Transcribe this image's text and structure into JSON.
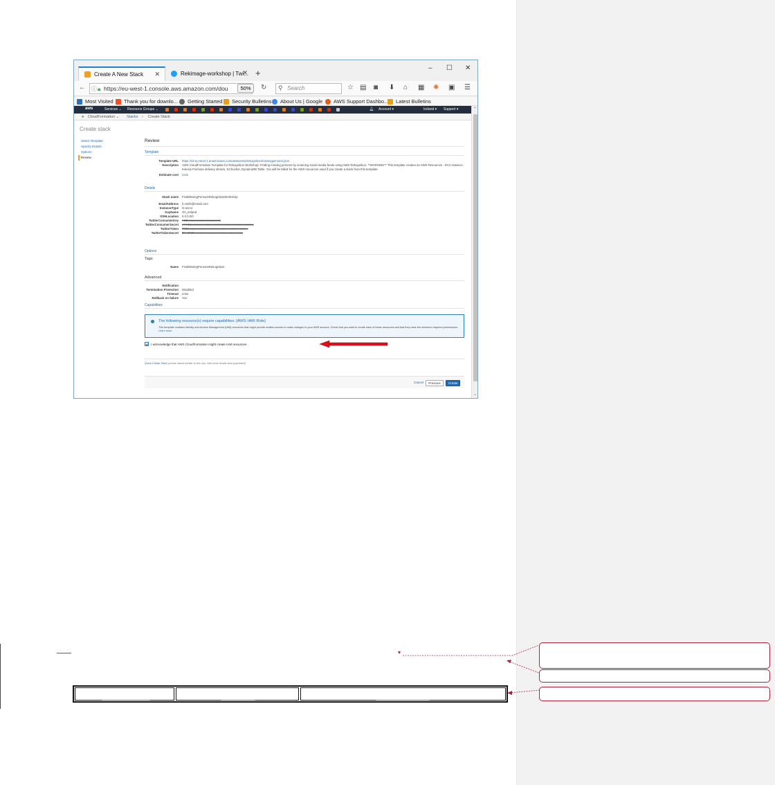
{
  "browser": {
    "tabs": [
      {
        "label": "Create A New Stack",
        "close": "✕"
      },
      {
        "label": "Rekimage-workshop | Twi...",
        "close": "✕"
      }
    ],
    "new_tab": "+",
    "window_controls": {
      "minimize": "–",
      "maximize": "☐",
      "close": "✕"
    },
    "url": "https://eu-west-1.console.aws.amazon.com/dou",
    "zoom": "50%",
    "search_placeholder": "Search",
    "bookmarks": [
      {
        "label": "Most Visited",
        "color": "#2f6fb8"
      },
      {
        "label": "Thank you for downlo...",
        "color": "#f25022"
      },
      {
        "label": "Getting Started",
        "color": "#666666"
      },
      {
        "label": "Security Bulletins",
        "color": "#e3a21a"
      },
      {
        "label": "About Us | Google",
        "color": "#4285f4"
      },
      {
        "label": "AWS Support Dashbo...",
        "color": "#e45b1b"
      },
      {
        "label": "Latest Bulletins",
        "color": "#e3a21a"
      }
    ]
  },
  "aws": {
    "logo": "aws",
    "services": "Services ⌄",
    "resource_groups": "Resource Groups ⌄",
    "account_menu": "Account ▾",
    "region": "Ireland ▾",
    "support": "Support ▾",
    "service_name": "CloudFormation ⌄",
    "breadcrumb": [
      "Stacks",
      "Create Stack"
    ],
    "page_title": "Create stack",
    "steps": [
      "Select Template",
      "Specify Details",
      "Options",
      "Review"
    ],
    "review": {
      "heading": "Review",
      "template_section": "Template",
      "template_rows": [
        {
          "k": "Template URL",
          "v": "https://s3-eu-west-1.amazonaws.com/awsevents/rekognition/missingpersons.json",
          "link": true
        },
        {
          "k": "Description",
          "v": "AWS CloudFormation Template for Rekognition Workshop: Finding missing persons by scanning social media feeds using AWS Rekognition. **WARNING** This template creates an AWS Resources - EC2 instance, Kinesis Firehose delivery stream, S3 bucket, DynamoDB Table. You will be billed for the AWS resources used if you create a stack from this template.",
          "link": false
        },
        {
          "k": "Estimate cost",
          "v": "Cost",
          "link": true
        }
      ],
      "details_section": "Details",
      "stack_name": {
        "k": "Stack name",
        "v": "FindMissingPersonsRekognitionWorkshop"
      },
      "param_rows": [
        {
          "k": "EmailAddress",
          "v": "b.smith@email.com",
          "strike": false
        },
        {
          "k": "InstanceType",
          "v": "t2.micro",
          "strike": false
        },
        {
          "k": "KeyName",
          "v": "cfn_ireland",
          "strike": false
        },
        {
          "k": "SSHLocation",
          "v": "0.0.0.0/0",
          "strike": false
        },
        {
          "k": "TwitterConsumerKey",
          "v": "H5Dxxxxxxxxxxxxxxxxxxxxxx",
          "strike": true
        },
        {
          "k": "TwitterConsumerSecret",
          "v": "xYmbaxxxxxxxxxxxxxxxxxxxxxxxxxxxxxxxxxxxxxxxxxx",
          "strike": true
        },
        {
          "k": "TwitterToken",
          "v": "7003xxxxxxxxxxxxxxxxxxxxxxxxxxxxxxxxxxxxxxxx",
          "strike": true
        },
        {
          "k": "TwitterTokenSecret",
          "v": "Dmx2SDxxxxxxxxxxxxxxxxxxxxxxxxxxxxxxxxx",
          "strike": true
        }
      ],
      "options_section": "Options",
      "tags_heading": "Tags",
      "tag_row": {
        "k": "Name",
        "v": "FindMissingPersonsRekognition"
      },
      "advanced_heading": "Advanced",
      "advanced_rows": [
        {
          "k": "Notification",
          "v": ""
        },
        {
          "k": "Termination Protection",
          "v": "Disabled"
        },
        {
          "k": "Timeout",
          "v": "none"
        },
        {
          "k": "Rollback on failure",
          "v": "Yes"
        }
      ],
      "capabilities_section": "Capabilities",
      "cap_title": "The following resource(s) require capabilities: [AWS::IAM::Role]",
      "cap_body": "This template contains Identity and Access Management (IAM) resources that might provide entities access to make changes to your AWS account. Check that you want to create each of these resources and that they have the minimum required permissions.",
      "cap_link": "Learn more.",
      "ack_label": "I acknowledge that AWS CloudFormation might create IAM resources.",
      "quick_create": "Quick-Create Stack",
      "quick_create_note": "(create stacks similar to this one, with most details auto-populated)",
      "cancel": "Cancel",
      "previous": "Previous",
      "create": "Create"
    }
  },
  "colors": {
    "arrow": "#e0101a",
    "comment_border": "#a8243d",
    "aws_dark": "#232f3e",
    "link": "#1f6bb3"
  }
}
